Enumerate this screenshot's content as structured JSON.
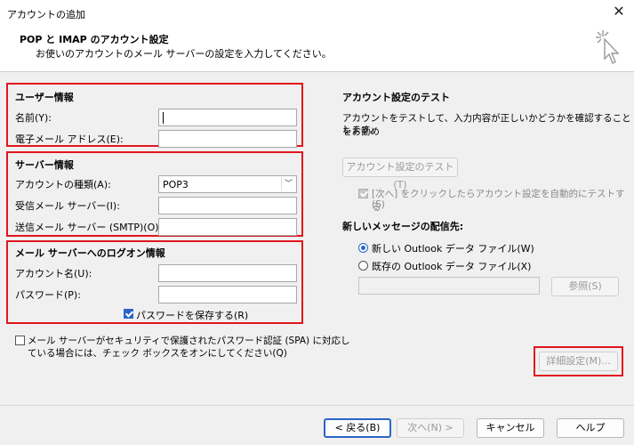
{
  "window": {
    "title": "アカウントの追加",
    "close_glyph": "✕"
  },
  "header": {
    "title": "POP と IMAP のアカウント設定",
    "subtitle": "お使いのアカウントのメール サーバーの設定を入力してください。",
    "icon": "wizard-cursor-icon"
  },
  "user_info": {
    "title": "ユーザー情報",
    "name_label": "名前(Y):",
    "name_value": "",
    "email_label": "電子メール アドレス(E):",
    "email_value": ""
  },
  "server_info": {
    "title": "サーバー情報",
    "account_type_label": "アカウントの種類(A):",
    "account_type_value": "POP3",
    "incoming_label": "受信メール サーバー(I):",
    "incoming_value": "",
    "outgoing_label": "送信メール サーバー (SMTP)(O):",
    "outgoing_value": ""
  },
  "logon_info": {
    "title": "メール サーバーへのログオン情報",
    "account_name_label": "アカウント名(U):",
    "account_name_value": "",
    "password_label": "パスワード(P):",
    "password_value": "",
    "save_password_label": "パスワードを保存する(R)",
    "save_password_checked": true
  },
  "spa": {
    "label_line1": "メール サーバーがセキュリティで保護されたパスワード認証 (SPA) に対応し",
    "label_line2": "ている場合には、チェック ボックスをオンにしてください(Q)",
    "checked": false
  },
  "test": {
    "title": "アカウント設定のテスト",
    "desc_line1": "アカウントをテストして、入力内容が正しいかどうかを確認することをお勧め",
    "desc_line2": "します。",
    "test_button": "アカウント設定のテスト(T)",
    "auto_test_line1": "[次へ] をクリックしたらアカウント設定を自動的にテストする",
    "auto_test_line2": "(S)"
  },
  "delivery": {
    "title": "新しいメッセージの配信先:",
    "option_new": "新しい Outlook データ ファイル(W)",
    "option_existing": "既存の Outlook データ ファイル(X)",
    "path_value": "",
    "browse_button": "参照(S)"
  },
  "advanced_button": "詳細設定(M)...",
  "footer": {
    "back": "< 戻る(B)",
    "next": "次へ(N) >",
    "cancel": "キャンセル",
    "help": "ヘルプ"
  },
  "colors": {
    "highlight": "#e0161e",
    "accent": "#2b65c8"
  }
}
